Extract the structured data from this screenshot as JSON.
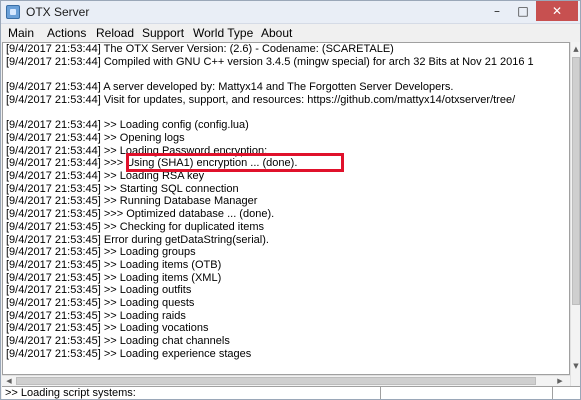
{
  "window": {
    "title": "OTX Server"
  },
  "window_controls": {
    "minimize": "–",
    "maximize": "□",
    "close": "✕"
  },
  "menu": [
    "Main",
    "Actions",
    "Reload",
    "Support",
    "World Type",
    "About"
  ],
  "console_lines": [
    "[9/4/2017 21:53:44] The OTX Server Version: (2.6) - Codename: (SCARETALE)",
    "[9/4/2017 21:53:44] Compiled with GNU C++ version 3.4.5 (mingw special) for arch 32 Bits at Nov 21 2016 1",
    "",
    "[9/4/2017 21:53:44] A server developed by: Mattyx14 and The Forgotten Server Developers.",
    "[9/4/2017 21:53:44] Visit for updates, support, and resources: https://github.com/mattyx14/otxserver/tree/",
    "",
    "[9/4/2017 21:53:44] >> Loading config (config.lua)",
    "[9/4/2017 21:53:44] >> Opening logs",
    "[9/4/2017 21:53:44] >> Loading Password encryption:",
    "[9/4/2017 21:53:44] >>> Using (SHA1) encryption ... (done).",
    "[9/4/2017 21:53:44] >> Loading RSA key",
    "[9/4/2017 21:53:45] >> Starting SQL connection",
    "[9/4/2017 21:53:45] >> Running Database Manager",
    "[9/4/2017 21:53:45] >>> Optimized database ... (done).",
    "[9/4/2017 21:53:45] >> Checking for duplicated items",
    "[9/4/2017 21:53:45] Error during getDataString(serial).",
    "[9/4/2017 21:53:45] >> Loading groups",
    "[9/4/2017 21:53:45] >> Loading items (OTB)",
    "[9/4/2017 21:53:45] >> Loading items (XML)",
    "[9/4/2017 21:53:45] >> Loading outfits",
    "[9/4/2017 21:53:45] >> Loading quests",
    "[9/4/2017 21:53:45] >> Loading raids",
    "[9/4/2017 21:53:45] >> Loading vocations",
    "[9/4/2017 21:53:45] >> Loading chat channels",
    "[9/4/2017 21:53:45] >> Loading experience stages"
  ],
  "status": {
    "text": ">> Loading script systems:"
  },
  "colors": {
    "highlight": "#e0112b",
    "close_button": "#c75050",
    "titlebar": "#e9eef6"
  }
}
